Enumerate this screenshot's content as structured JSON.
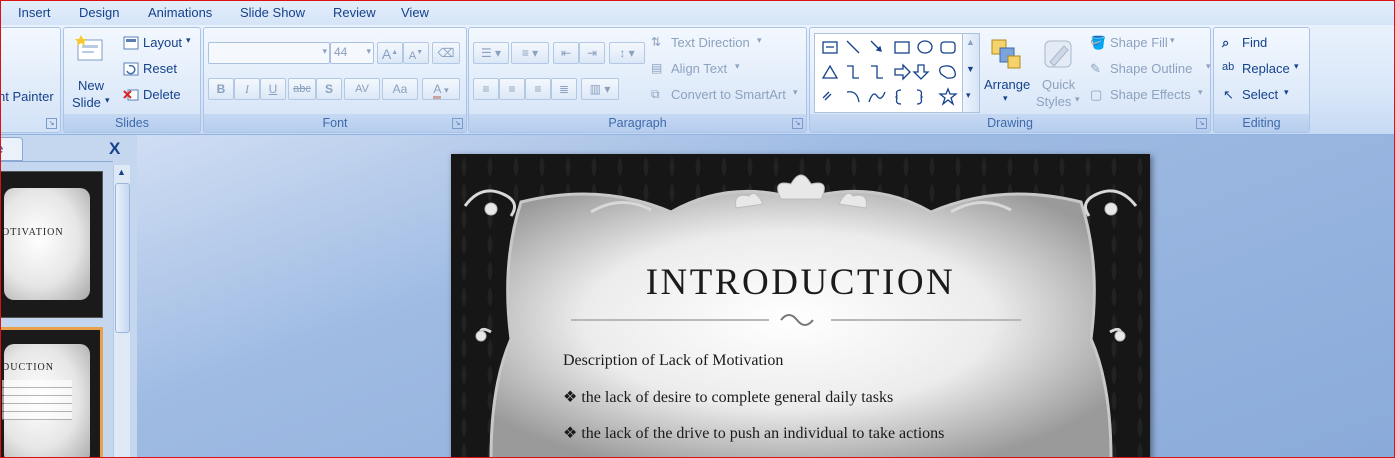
{
  "tabs": [
    "Insert",
    "Design",
    "Animations",
    "Slide Show",
    "Review",
    "View"
  ],
  "clipboard": {
    "format_painter": "nt Painter"
  },
  "slides": {
    "group_label": "Slides",
    "new_slide_line1": "New",
    "new_slide_line2": "Slide",
    "layout": "Layout",
    "reset": "Reset",
    "delete": "Delete"
  },
  "font": {
    "group_label": "Font",
    "font_name": "",
    "font_size": "44",
    "bold": "B",
    "italic": "I",
    "underline": "U",
    "strike": "abc",
    "shadow": "S",
    "spacing": "AV",
    "case": "Aa",
    "color": "A",
    "grow": "A",
    "shrink": "A"
  },
  "paragraph": {
    "group_label": "Paragraph",
    "text_direction": "Text Direction",
    "align_text": "Align Text",
    "convert_smartart": "Convert to SmartArt"
  },
  "drawing": {
    "group_label": "Drawing",
    "arrange": "Arrange",
    "quick_styles_1": "Quick",
    "quick_styles_2": "Styles",
    "shape_fill": "Shape Fill",
    "shape_outline": "Shape Outline",
    "shape_effects": "Shape Effects"
  },
  "editing": {
    "group_label": "Editing",
    "find": "Find",
    "replace": "Replace",
    "select": "Select"
  },
  "pane": {
    "tab_fragment": "e",
    "close": "X"
  },
  "thumbnails": [
    {
      "title": "OTIVATION",
      "selected": false
    },
    {
      "title": "DUCTION",
      "selected": true
    }
  ],
  "slide": {
    "title": "INTRODUCTION",
    "body": [
      {
        "bullet": "",
        "text": "Description of Lack of Motivation"
      },
      {
        "bullet": "❖",
        "text": "the lack of  desire to complete general daily tasks"
      },
      {
        "bullet": "❖",
        "text": "the lack of the drive to push an individual to take actions"
      }
    ]
  },
  "colors": {
    "accent": "#15428b",
    "ribbon": "#dbe8f9",
    "selection": "#e8a04a"
  }
}
